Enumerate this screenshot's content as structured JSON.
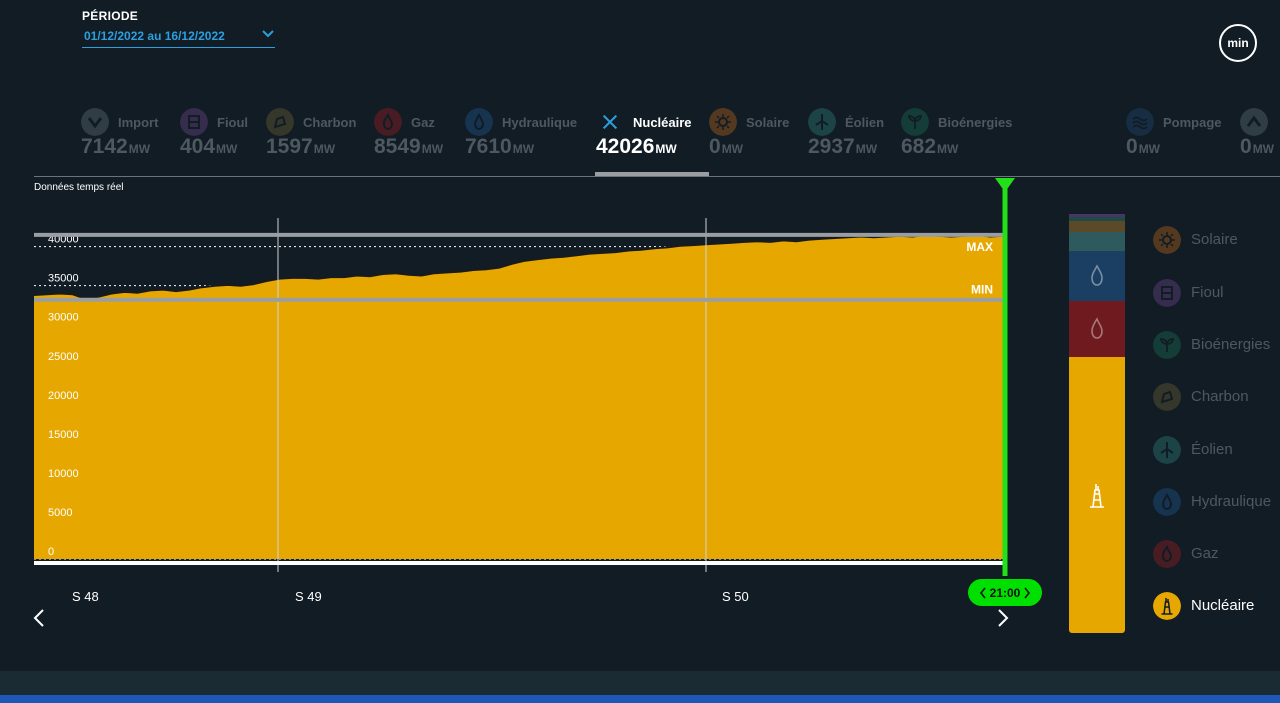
{
  "period": {
    "label": "PÉRIODE",
    "value": "01/12/2022 au 16/12/2022"
  },
  "min_button": "min",
  "tabs": [
    {
      "label": "Import",
      "value": "7142",
      "unit": "MW",
      "color": "#6b7b83",
      "icon": "import-arrow-icon"
    },
    {
      "label": "Fioul",
      "value": "404",
      "unit": "MW",
      "color": "#7a4f9c",
      "icon": "fuel-barrel-icon"
    },
    {
      "label": "Charbon",
      "value": "1597",
      "unit": "MW",
      "color": "#7a6a3a",
      "icon": "coal-icon"
    },
    {
      "label": "Gaz",
      "value": "8549",
      "unit": "MW",
      "color": "#b01e24",
      "icon": "flame-icon"
    },
    {
      "label": "Hydraulique",
      "value": "7610",
      "unit": "MW",
      "color": "#1f5fa0",
      "icon": "water-drop-icon"
    },
    {
      "label": "Nucléaire",
      "value": "42026",
      "unit": "MW",
      "color": "#e6a800",
      "icon": "close-x-icon",
      "active": true
    },
    {
      "label": "Solaire",
      "value": "0",
      "unit": "MW",
      "color": "#d0701a",
      "icon": "sun-icon"
    },
    {
      "label": "Éolien",
      "value": "2937",
      "unit": "MW",
      "color": "#2f8f8a",
      "icon": "wind-turbine-icon"
    },
    {
      "label": "Bioénergies",
      "value": "682",
      "unit": "MW",
      "color": "#1b7a5e",
      "icon": "leaf-icon"
    },
    {
      "label": "Pompage",
      "value": "0",
      "unit": "MW",
      "color": "#1f4f80",
      "icon": "waves-icon"
    },
    {
      "label": "",
      "value": "0",
      "unit": "MW",
      "color": "#6b7b83",
      "icon": "export-arrow-icon"
    }
  ],
  "realtime_label": "Données temps réel",
  "chart_data": {
    "type": "area",
    "series_color": "#e6a800",
    "y_ticks": [
      0,
      5000,
      10000,
      15000,
      20000,
      25000,
      30000,
      35000,
      40000
    ],
    "ylim": [
      0,
      42000
    ],
    "max_value": 41500,
    "min_value": 33200,
    "max_label": "MAX",
    "min_label": "MIN",
    "week_labels": [
      "S 48",
      "S 49",
      "S 50"
    ],
    "series": [
      {
        "values": [
          33800,
          33900,
          34000,
          33900,
          33300,
          33600,
          34000,
          34200,
          34100,
          34400,
          34500,
          34300,
          34500,
          34800,
          35000,
          35100,
          35000,
          35200,
          35600,
          35900,
          36000,
          36000,
          35900,
          36100,
          36100,
          36300,
          36200,
          36500,
          36600,
          36400,
          36300,
          36600,
          36700,
          36800,
          37000,
          37100,
          37300,
          37800,
          38200,
          38400,
          38600,
          38700,
          38900,
          39100,
          39200,
          39300,
          39500,
          39600,
          39800,
          39900,
          40100,
          40200,
          40300,
          40400,
          40500,
          40600,
          40700,
          40600,
          40800,
          40700,
          40900,
          41000,
          41100,
          41200,
          41300,
          41200,
          41300,
          41400,
          41300,
          41500,
          41400,
          41300,
          41400,
          41500,
          41300,
          41400
        ]
      }
    ]
  },
  "cursor_time": "21:00",
  "stack_segments": [
    {
      "name": "Nucléaire",
      "color": "#e6a800",
      "value": 42026
    },
    {
      "name": "Gaz",
      "color": "#6e1a1e",
      "value": 8549
    },
    {
      "name": "Hydraulique",
      "color": "#1b3f63",
      "value": 7610
    },
    {
      "name": "Éolien",
      "color": "#2e5a5e",
      "value": 2937
    },
    {
      "name": "Charbon",
      "color": "#5a4a2a",
      "value": 1597
    },
    {
      "name": "Bioénergies",
      "color": "#1f4b44",
      "value": 682
    },
    {
      "name": "Fioul",
      "color": "#4a3366",
      "value": 404
    }
  ],
  "legend": [
    {
      "label": "Solaire",
      "color": "#d0701a",
      "icon": "sun-icon"
    },
    {
      "label": "Fioul",
      "color": "#7a4f9c",
      "icon": "fuel-barrel-icon"
    },
    {
      "label": "Bioénergies",
      "color": "#1b7a5e",
      "icon": "leaf-icon"
    },
    {
      "label": "Charbon",
      "color": "#7a6a3a",
      "icon": "coal-icon"
    },
    {
      "label": "Éolien",
      "color": "#2f8f8a",
      "icon": "wind-turbine-icon"
    },
    {
      "label": "Hydraulique",
      "color": "#1f5fa0",
      "icon": "water-drop-icon"
    },
    {
      "label": "Gaz",
      "color": "#b01e24",
      "icon": "flame-icon"
    },
    {
      "label": "Nucléaire",
      "color": "#e6a800",
      "icon": "nuclear-plant-icon",
      "active": true
    }
  ]
}
